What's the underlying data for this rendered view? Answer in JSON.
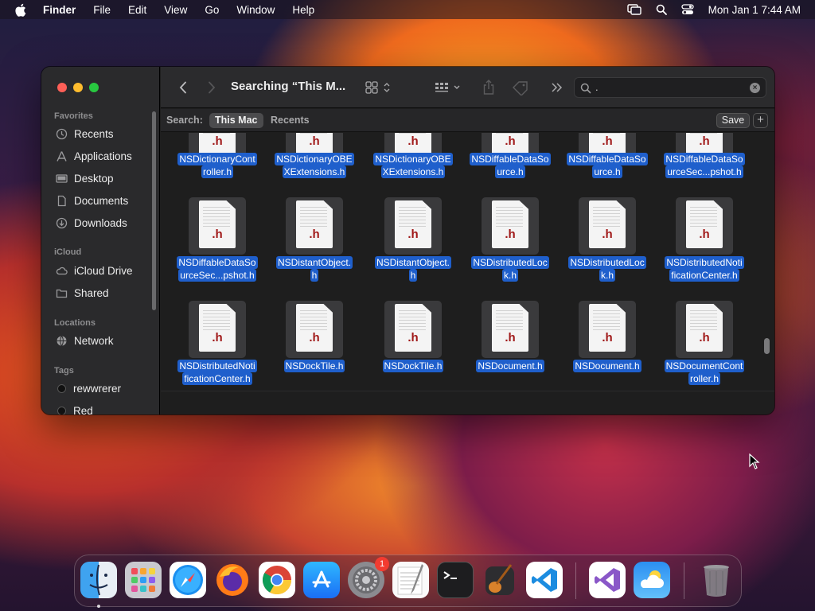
{
  "menubar": {
    "app_name": "Finder",
    "items": [
      "File",
      "Edit",
      "View",
      "Go",
      "Window",
      "Help"
    ],
    "clock": "Mon Jan 1  7:44 AM"
  },
  "finder": {
    "title": "Searching “This M...",
    "search_query": ".",
    "scope": {
      "label": "Search:",
      "options": [
        {
          "label": "This Mac",
          "active": true
        },
        {
          "label": "Recents",
          "active": false
        }
      ],
      "save_label": "Save",
      "add_label": "+"
    },
    "sidebar": {
      "sections": [
        {
          "title": "Favorites",
          "items": [
            {
              "label": "Recents",
              "icon": "clock-icon"
            },
            {
              "label": "Applications",
              "icon": "applications-icon"
            },
            {
              "label": "Desktop",
              "icon": "desktop-icon"
            },
            {
              "label": "Documents",
              "icon": "document-icon"
            },
            {
              "label": "Downloads",
              "icon": "download-icon"
            }
          ]
        },
        {
          "title": "iCloud",
          "items": [
            {
              "label": "iCloud Drive",
              "icon": "cloud-icon"
            },
            {
              "label": "Shared",
              "icon": "shared-folder-icon"
            }
          ]
        },
        {
          "title": "Locations",
          "items": [
            {
              "label": "Network",
              "icon": "network-icon"
            }
          ]
        },
        {
          "title": "Tags",
          "items": [
            {
              "label": "rewwrerer",
              "color": "#1a1a1a"
            },
            {
              "label": "Red",
              "color": "#1a1a1a"
            }
          ]
        }
      ]
    },
    "files": [
      {
        "name": "NSDictionaryController.h",
        "lines": [
          "NSDictionaryCont",
          "roller.h"
        ]
      },
      {
        "name": "NSDictionaryOBEXExtensions.h",
        "lines": [
          "NSDictionaryOBE",
          "XExtensions.h"
        ]
      },
      {
        "name": "NSDictionaryOBEXExtensions.h",
        "lines": [
          "NSDictionaryOBE",
          "XExtensions.h"
        ]
      },
      {
        "name": "NSDiffableDataSource.h",
        "lines": [
          "NSDiffableDataSo",
          "urce.h"
        ]
      },
      {
        "name": "NSDiffableDataSource.h",
        "lines": [
          "NSDiffableDataSo",
          "urce.h"
        ]
      },
      {
        "name": "NSDiffableDataSourceSec...pshot.h",
        "lines": [
          "NSDiffableDataSo",
          "urceSec...pshot.h"
        ]
      },
      {
        "name": "NSDiffableDataSourceSec...pshot.h",
        "lines": [
          "NSDiffableDataSo",
          "urceSec...pshot.h"
        ]
      },
      {
        "name": "NSDistantObject.h",
        "lines": [
          "NSDistantObject.",
          "h"
        ]
      },
      {
        "name": "NSDistantObject.h",
        "lines": [
          "NSDistantObject.",
          "h"
        ]
      },
      {
        "name": "NSDistributedLock.h",
        "lines": [
          "NSDistributedLoc",
          "k.h"
        ]
      },
      {
        "name": "NSDistributedLock.h",
        "lines": [
          "NSDistributedLoc",
          "k.h"
        ]
      },
      {
        "name": "NSDistributedNotificationCenter.h",
        "lines": [
          "NSDistributedNoti",
          "ficationCenter.h"
        ]
      },
      {
        "name": "NSDistributedNotificationCenter.h",
        "lines": [
          "NSDistributedNoti",
          "ficationCenter.h"
        ]
      },
      {
        "name": "NSDockTile.h",
        "lines": [
          "NSDockTile.h"
        ]
      },
      {
        "name": "NSDockTile.h",
        "lines": [
          "NSDockTile.h"
        ]
      },
      {
        "name": "NSDocument.h",
        "lines": [
          "NSDocument.h"
        ]
      },
      {
        "name": "NSDocument.h",
        "lines": [
          "NSDocument.h"
        ]
      },
      {
        "name": "NSDocumentController.h",
        "lines": [
          "NSDocumentCont",
          "roller.h"
        ]
      }
    ],
    "file_ext_label": ".h"
  },
  "dock": {
    "apps": [
      {
        "name": "Finder",
        "icon": "finder-icon"
      },
      {
        "name": "Launchpad",
        "icon": "launchpad-icon"
      },
      {
        "name": "Safari",
        "icon": "safari-icon"
      },
      {
        "name": "Firefox",
        "icon": "firefox-icon"
      },
      {
        "name": "Chrome",
        "icon": "chrome-icon"
      },
      {
        "name": "App Store",
        "icon": "app-store-icon"
      },
      {
        "name": "System Settings",
        "icon": "settings-icon",
        "badge": "1"
      },
      {
        "name": "TextEdit",
        "icon": "textedit-icon"
      },
      {
        "name": "Terminal",
        "icon": "terminal-icon"
      },
      {
        "name": "Instruments",
        "icon": "guitar-icon"
      },
      {
        "name": "Visual Studio Code",
        "icon": "vscode-icon"
      },
      {
        "name": "Visual Studio",
        "icon": "visual-studio-icon"
      },
      {
        "name": "Weather",
        "icon": "weather-icon"
      },
      {
        "name": "Trash",
        "icon": "trash-icon"
      }
    ]
  }
}
